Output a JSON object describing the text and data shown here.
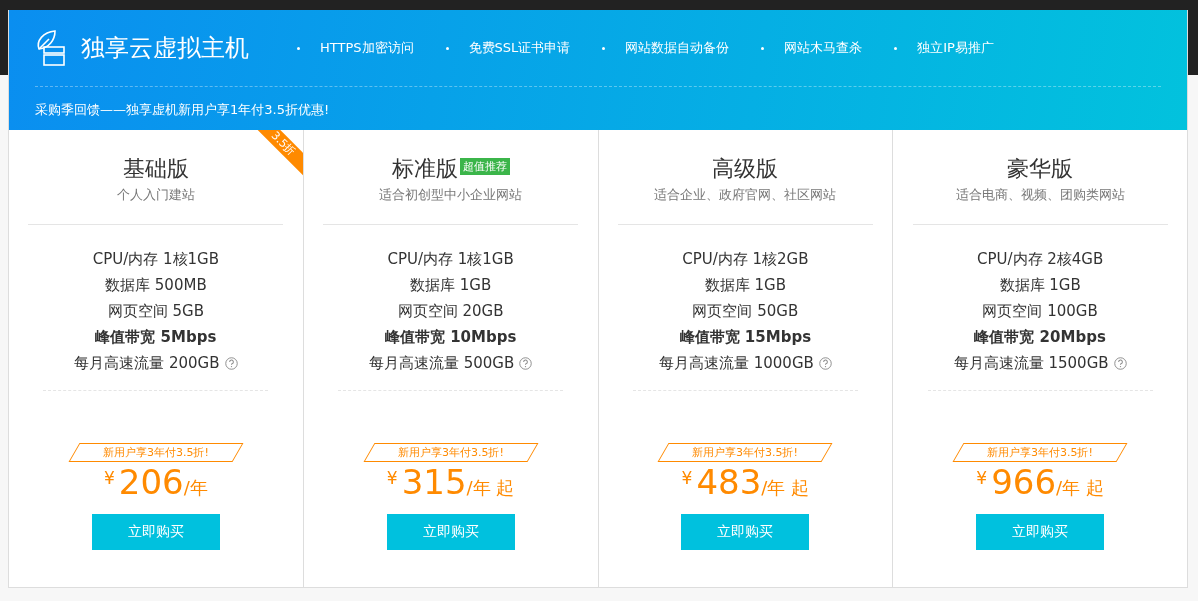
{
  "header": {
    "title": "独享云虚拟主机",
    "features": [
      "HTTPS加密访问",
      "免费SSL证书申请",
      "网站数据自动备份",
      "网站木马查杀",
      "独立IP易推广"
    ],
    "promo": "采购季回馈——独享虚机新用户享1年付3.5折优惠!"
  },
  "plans": [
    {
      "name": "基础版",
      "ribbon": "3.5折",
      "subtitle": "个人入门建站",
      "specs": [
        {
          "text": "CPU/内存 1核1GB",
          "bold": false,
          "help": false
        },
        {
          "text": "数据库 500MB",
          "bold": false,
          "help": false
        },
        {
          "text": "网页空间 5GB",
          "bold": false,
          "help": false
        },
        {
          "text": "峰值带宽 5Mbps",
          "bold": true,
          "help": false
        },
        {
          "text": "每月高速流量 200GB",
          "bold": false,
          "help": true
        }
      ],
      "offer": "新用户享3年付3.5折!",
      "currency": "¥",
      "price": "206",
      "unit": "/年",
      "button": "立即购买"
    },
    {
      "name": "标准版",
      "tag": "超值推荐",
      "subtitle": "适合初创型中小企业网站",
      "specs": [
        {
          "text": "CPU/内存 1核1GB",
          "bold": false,
          "help": false
        },
        {
          "text": "数据库 1GB",
          "bold": false,
          "help": false
        },
        {
          "text": "网页空间 20GB",
          "bold": false,
          "help": false
        },
        {
          "text": "峰值带宽 10Mbps",
          "bold": true,
          "help": false
        },
        {
          "text": "每月高速流量 500GB",
          "bold": false,
          "help": true
        }
      ],
      "offer": "新用户享3年付3.5折!",
      "currency": "¥",
      "price": "315",
      "unit": "/年 起",
      "button": "立即购买"
    },
    {
      "name": "高级版",
      "subtitle": "适合企业、政府官网、社区网站",
      "specs": [
        {
          "text": "CPU/内存 1核2GB",
          "bold": false,
          "help": false
        },
        {
          "text": "数据库 1GB",
          "bold": false,
          "help": false
        },
        {
          "text": "网页空间 50GB",
          "bold": false,
          "help": false
        },
        {
          "text": "峰值带宽 15Mbps",
          "bold": true,
          "help": false
        },
        {
          "text": "每月高速流量 1000GB",
          "bold": false,
          "help": true
        }
      ],
      "offer": "新用户享3年付3.5折!",
      "currency": "¥",
      "price": "483",
      "unit": "/年 起",
      "button": "立即购买"
    },
    {
      "name": "豪华版",
      "subtitle": "适合电商、视频、团购类网站",
      "specs": [
        {
          "text": "CPU/内存 2核4GB",
          "bold": false,
          "help": false
        },
        {
          "text": "数据库 1GB",
          "bold": false,
          "help": false
        },
        {
          "text": "网页空间 100GB",
          "bold": false,
          "help": false
        },
        {
          "text": "峰值带宽 20Mbps",
          "bold": true,
          "help": false
        },
        {
          "text": "每月高速流量 1500GB",
          "bold": false,
          "help": true
        }
      ],
      "offer": "新用户享3年付3.5折!",
      "currency": "¥",
      "price": "966",
      "unit": "/年 起",
      "button": "立即购买"
    }
  ]
}
